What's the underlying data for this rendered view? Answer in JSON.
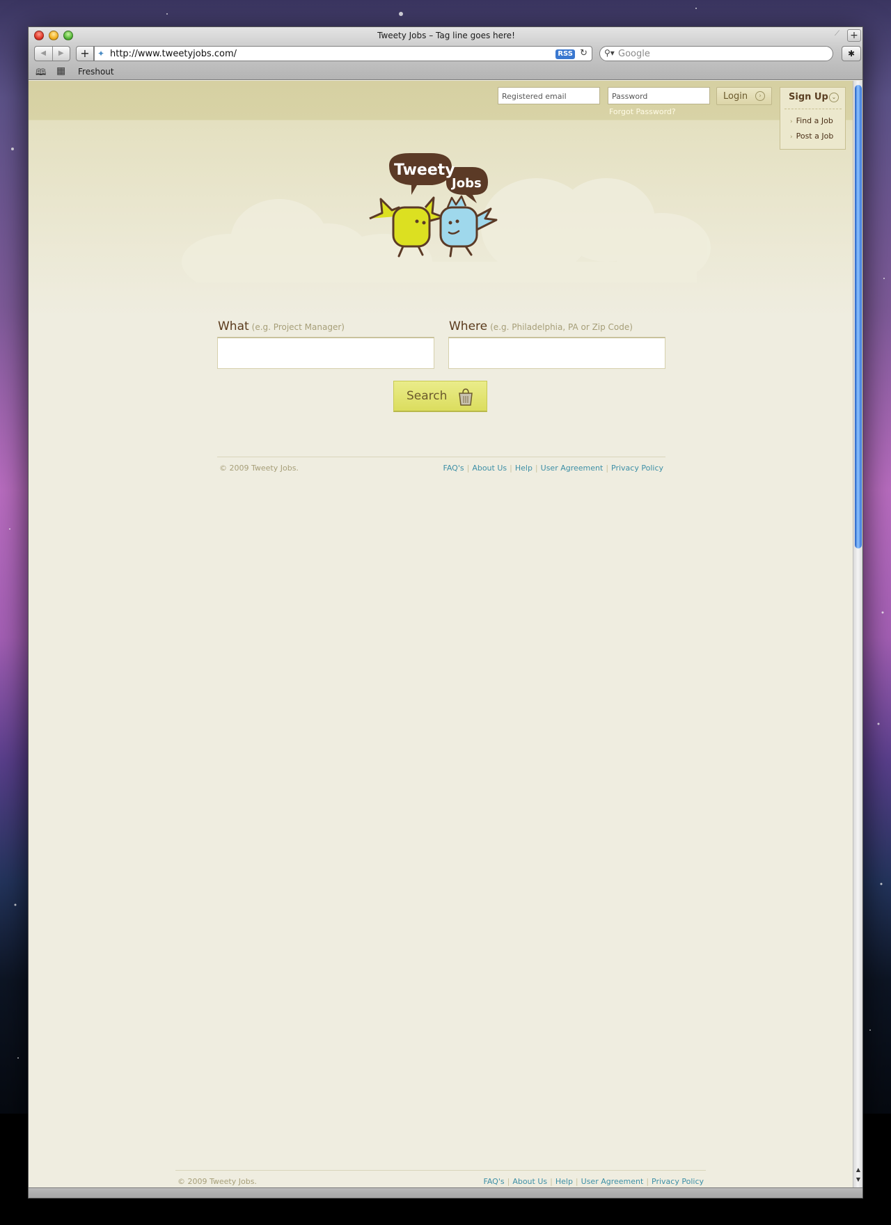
{
  "browser": {
    "window_title": "Tweety Jobs – Tag line goes here!",
    "url": "http://www.tweetyjobs.com/",
    "rss_badge": "RSS",
    "search_placeholder": "Google",
    "bookmarks": [
      "Freshout"
    ],
    "icons": [
      "back-icon",
      "forward-icon",
      "add-bookmark-icon",
      "reload-icon",
      "search-icon",
      "bug-icon",
      "bookmarks-book-icon",
      "top-sites-grid-icon"
    ]
  },
  "header": {
    "email_placeholder": "Registered email",
    "password_placeholder": "Password",
    "login_label": "Login",
    "forgot_password": "Forgot Password?",
    "signup": {
      "title": "Sign Up",
      "items": [
        "Find a Job",
        "Post a Job"
      ]
    }
  },
  "logo": {
    "word1": "Tweety",
    "word2": "Jobs"
  },
  "search": {
    "what_label": "What",
    "what_hint": "(e.g. Project Manager)",
    "where_label": "Where",
    "where_hint": "(e.g. Philadelphia, PA or Zip Code)",
    "button_label": "Search"
  },
  "footer": {
    "copyright": "© 2009 Tweety Jobs.",
    "links": [
      "FAQ's",
      "About Us",
      "Help",
      "User Agreement",
      "Privacy Policy"
    ]
  },
  "colors": {
    "header_bg": "#d6d0a2",
    "page_bg": "#efede0",
    "link": "#3d8fa6",
    "brand_brown": "#5a3a1c",
    "search_button": "#e2e474"
  }
}
